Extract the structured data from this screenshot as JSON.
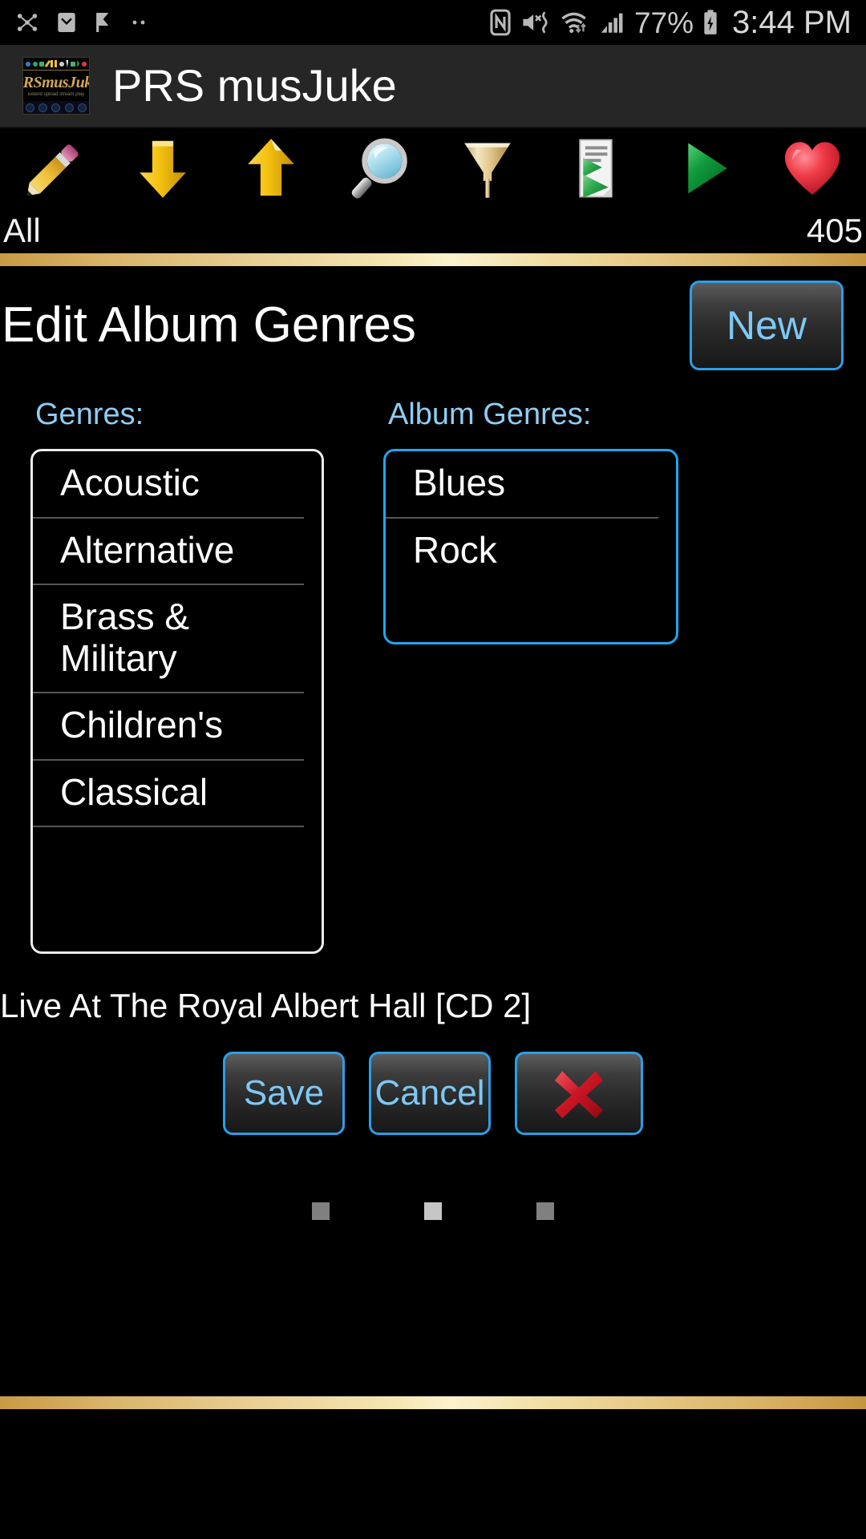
{
  "status_bar": {
    "left_icons": [
      "bluetooth-share-icon",
      "email-icon",
      "check-flag-icon",
      "more-dots-icon"
    ],
    "right_icons": [
      "nfc-icon",
      "mute-vibrate-icon",
      "wifi-icon",
      "cellular-signal-icon",
      "battery-charging-icon"
    ],
    "battery_percent": "77%",
    "clock": "3:44 PM"
  },
  "app_bar": {
    "title": "PRS musJuke",
    "logo": {
      "brand": "PRSmusJuke",
      "tagline": "extend upload stream play"
    }
  },
  "toolbar": {
    "items": [
      {
        "name": "edit-pencil-icon",
        "label": "Edit"
      },
      {
        "name": "download-arrow-icon",
        "label": "Download"
      },
      {
        "name": "upload-arrow-icon",
        "label": "Upload"
      },
      {
        "name": "search-magnifier-icon",
        "label": "Search"
      },
      {
        "name": "filter-funnel-icon",
        "label": "Filter"
      },
      {
        "name": "playlist-document-icon",
        "label": "Playlist"
      },
      {
        "name": "play-triangle-icon",
        "label": "Play"
      },
      {
        "name": "favorite-heart-icon",
        "label": "Favorites"
      }
    ]
  },
  "filter_row": {
    "scope": "All",
    "count": "405"
  },
  "page": {
    "title": "Edit Album Genres",
    "new_button": "New"
  },
  "genres_panel": {
    "label": "Genres:",
    "items": [
      "Acoustic",
      "Alternative",
      "Brass & Military",
      "Children's",
      "Classical"
    ]
  },
  "album_genres_panel": {
    "label": "Album Genres:",
    "items": [
      "Blues",
      "Rock"
    ]
  },
  "album": {
    "name": "Live At The Royal Albert Hall [CD 2]"
  },
  "actions": {
    "save": "Save",
    "cancel": "Cancel",
    "delete_icon": "red-x-delete-icon"
  },
  "pager": {
    "dots": [
      "inactive",
      "active",
      "inactive"
    ]
  },
  "colors": {
    "accent_blue": "#21a6ef",
    "label_blue": "#8ecdf2",
    "button_text_blue": "#7ec8f5",
    "gold_bar": "#e8cd92",
    "background": "#000000",
    "appbar_background": "#262626"
  }
}
